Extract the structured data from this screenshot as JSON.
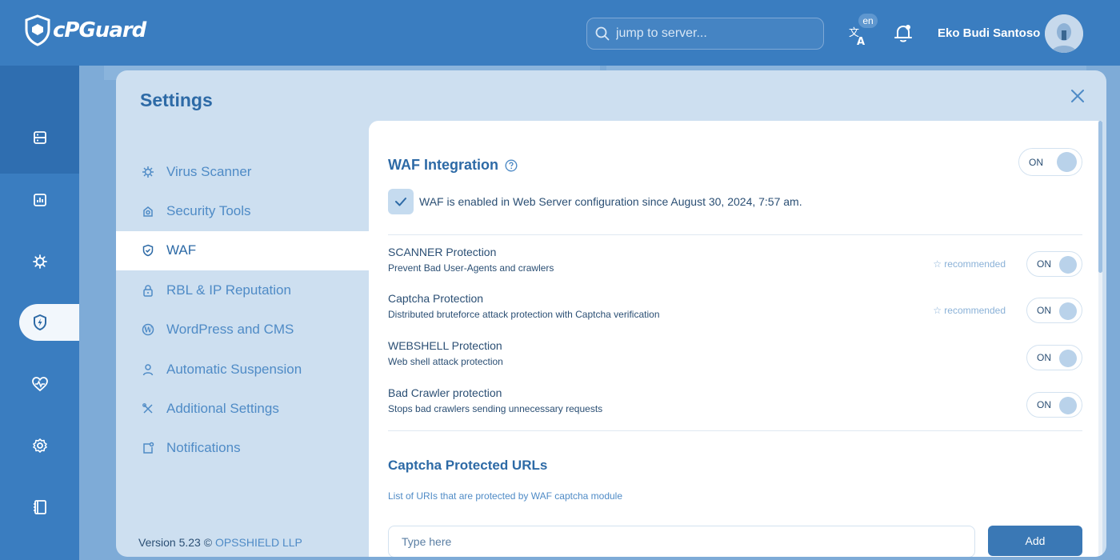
{
  "header": {
    "brand": "cPGuard",
    "search_placeholder": "jump to server...",
    "language_badge": "en",
    "user_name": "Eko Budi Santoso"
  },
  "rail": {
    "items": [
      {
        "icon": "server-icon"
      },
      {
        "icon": "bar-chart-icon"
      },
      {
        "icon": "virus-icon"
      },
      {
        "icon": "shield-bolt-icon",
        "active": true
      },
      {
        "icon": "heartbeat-icon"
      },
      {
        "icon": "settings-icon"
      },
      {
        "icon": "notebook-icon"
      }
    ]
  },
  "settings": {
    "title": "Settings",
    "nav": [
      {
        "label": "Virus Scanner",
        "icon": "virus-icon"
      },
      {
        "label": "Security Tools",
        "icon": "security-tools-icon"
      },
      {
        "label": "WAF",
        "icon": "shield-check-icon",
        "active": true
      },
      {
        "label": "RBL & IP Reputation",
        "icon": "lock-icon"
      },
      {
        "label": "WordPress and CMS",
        "icon": "wordpress-icon"
      },
      {
        "label": "Automatic Suspension",
        "icon": "user-icon"
      },
      {
        "label": "Additional Settings",
        "icon": "tools-icon"
      },
      {
        "label": "Notifications",
        "icon": "notification-icon"
      }
    ],
    "version_text": "Version 5.23 ©",
    "version_company": "OPSSHIELD LLP"
  },
  "waf": {
    "title": "WAF Integration",
    "toggle": "ON",
    "enabled_text": "WAF is enabled in Web Server configuration since August 30, 2024, 7:57 am.",
    "rules": [
      {
        "title": "SCANNER Protection",
        "desc": "Prevent Bad User-Agents and crawlers",
        "recommended": "recommended",
        "toggle": "ON"
      },
      {
        "title": "Captcha Protection",
        "desc": "Distributed bruteforce attack protection with Captcha verification",
        "recommended": "recommended",
        "toggle": "ON"
      },
      {
        "title": "WEBSHELL Protection",
        "desc": "Web shell attack protection",
        "recommended": "",
        "toggle": "ON"
      },
      {
        "title": "Bad Crawler protection",
        "desc": "Stops bad crawlers sending unnecessary requests",
        "recommended": "",
        "toggle": "ON"
      }
    ],
    "captcha_section": {
      "title": "Captcha Protected URLs",
      "desc": "List of URIs that are protected by WAF captcha module",
      "input_placeholder": "Type here",
      "add_label": "Add"
    }
  },
  "colors": {
    "brand_blue": "#3a7dc0",
    "accent_text": "#2d6aa6",
    "button": "#3a78b5"
  }
}
